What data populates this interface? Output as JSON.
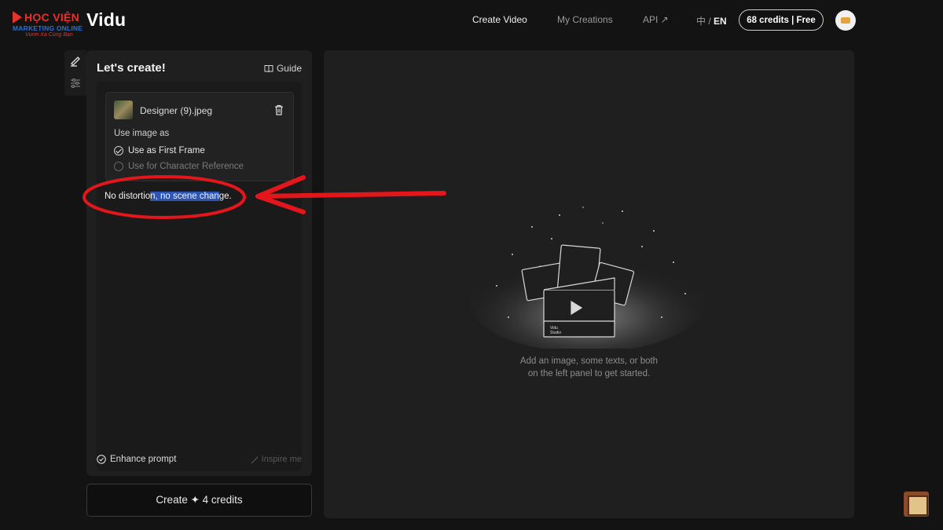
{
  "watermark": {
    "line1": "HỌC VIỆN",
    "line2": "MARKETING ONLINE",
    "line3": "Vươn Xa Cùng Bạn"
  },
  "header": {
    "brand": "Vidu",
    "nav": [
      {
        "label": "Create Video",
        "active": true
      },
      {
        "label": "My Creations",
        "active": false
      },
      {
        "label": "API ↗",
        "active": false
      }
    ],
    "lang_zh": "中",
    "lang_sep": " / ",
    "lang_en": "EN",
    "credits": "68 credits | Free"
  },
  "panel": {
    "title": "Let's create!",
    "guide": "Guide",
    "image": {
      "filename": "Designer (9).jpeg",
      "use_as_label": "Use image as",
      "options": [
        {
          "label": "Use as First Frame",
          "selected": true
        },
        {
          "label": "Use for Character Reference",
          "selected": false
        }
      ]
    },
    "prompt": {
      "before": "No distortio",
      "highlighted": "n, no scene chan",
      "after": "ge."
    },
    "enhance": "Enhance prompt",
    "inspire": "Inspire me"
  },
  "create_button": "Create ✦ 4 credits",
  "preview": {
    "empty_line1": "Add an image, some texts, or both",
    "empty_line2": "on the left panel to get started.",
    "studio_label_1": "Vidu",
    "studio_label_2": "Studio"
  },
  "colors": {
    "background": "#131313",
    "panel": "#1f1f1f",
    "annotation_red": "#e2161b",
    "highlight": "#2d55b4"
  }
}
